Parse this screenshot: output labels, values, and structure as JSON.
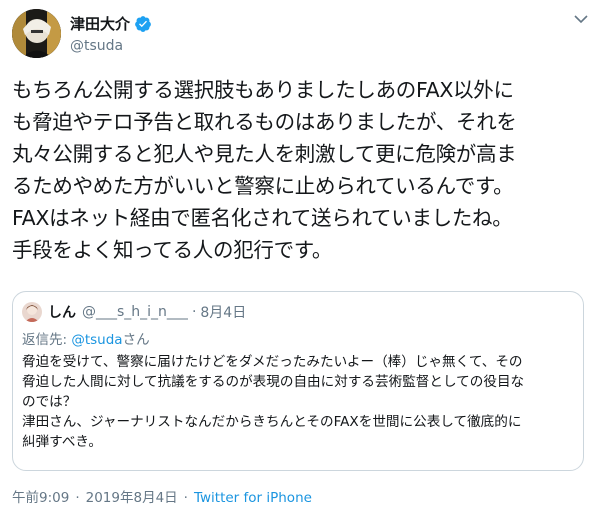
{
  "author": {
    "display_name": "津田大介",
    "handle": "@tsuda",
    "verified": true,
    "verified_icon": "verified-badge-icon"
  },
  "tweet": {
    "lines": [
      "もちろん公開する選択肢もありましたしあのFAX以外に",
      "も脅迫やテロ予告と取れるものはありましたが、それを",
      "丸々公開すると犯人や見た人を刺激して更に危険が高ま",
      "るためやめた方がいいと警察に止められているんです。",
      "FAXはネット経由で匿名化されて送られていましたね。",
      "手段をよく知ってる人の犯行です。"
    ]
  },
  "quoted_tweet": {
    "display_name": "しん",
    "handle": "@___s_h_i_n___",
    "separator": "·",
    "date": "8月4日",
    "reply_prefix": "返信先: ",
    "reply_mention": "@tsuda",
    "reply_suffix": "さん",
    "lines": [
      "脅迫を受けて、警察に届けたけどをダメだったみたいよー（棒）じゃ無くて、その",
      "脅迫した人間に対して抗議をするのが表現の自由に対する芸術監督としての役目な",
      "のでは？",
      "津田さん、ジャーナリストなんだからきちんとそのFAXを世間に公表して徹底的に",
      "糾弾すべき。"
    ]
  },
  "footer": {
    "time": "午前9:09",
    "date": "2019年8月4日",
    "separator": "·",
    "source": "Twitter for iPhone"
  },
  "colors": {
    "link": "#1b95e0",
    "muted": "#657786",
    "text": "#14171a",
    "border": "#ccd6dd",
    "verified": "#1da1f2"
  }
}
